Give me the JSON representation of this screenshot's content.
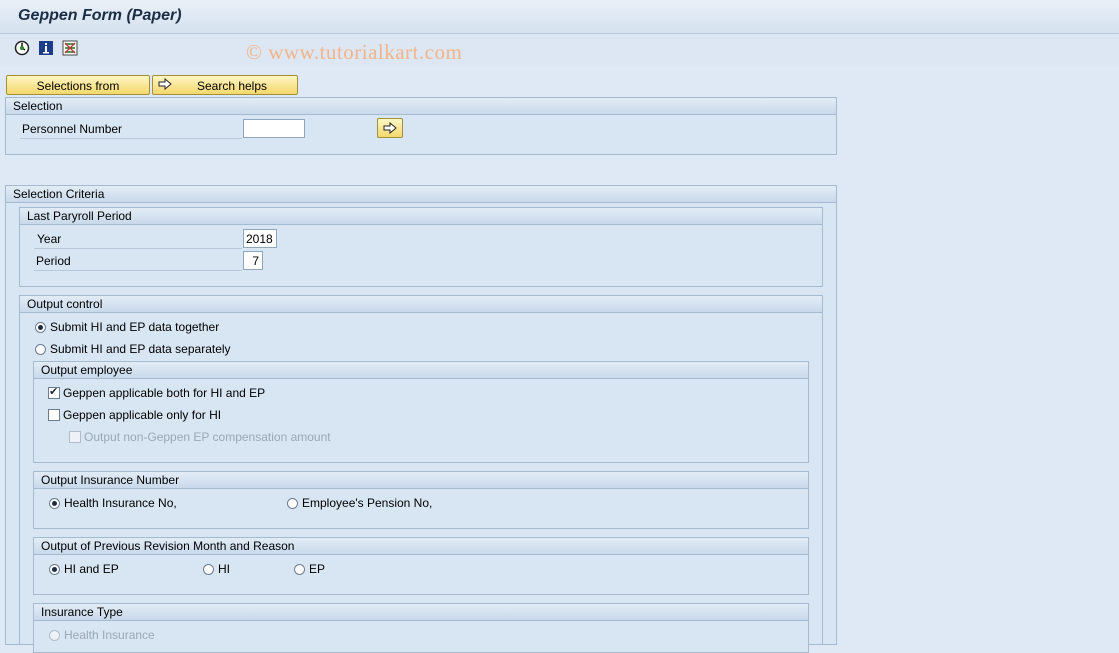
{
  "window": {
    "title": "Geppen Form (Paper)"
  },
  "toolbar": {
    "icons": [
      "execute-icon",
      "info-icon",
      "selection-options-icon"
    ],
    "watermark": "© www.tutorialkart.com"
  },
  "buttons": {
    "selections_from": "Selections from",
    "search_helps": "Search helps"
  },
  "selection": {
    "header": "Selection",
    "personnel_number_label": "Personnel Number",
    "personnel_number_value": ""
  },
  "criteria": {
    "header": "Selection Criteria",
    "last_payroll": {
      "header": "Last Paryroll Period",
      "year_label": "Year",
      "year_value": "2018",
      "period_label": "Period",
      "period_value": "7"
    },
    "output_control": {
      "header": "Output control",
      "opt_together": "Submit HI and EP data together",
      "opt_separately": "Submit HI and EP data separately",
      "selected": "together"
    },
    "output_employee": {
      "header": "Output employee",
      "both_label": "Geppen applicable both for HI and EP",
      "both_checked": true,
      "only_hi_label": "Geppen applicable only for HI",
      "only_hi_checked": false,
      "non_geppen_label": "Output non-Geppen EP compensation amount",
      "non_geppen_checked": false
    },
    "output_insurance": {
      "header": "Output Insurance Number",
      "health": "Health Insurance No,",
      "pension": "Employee's Pension No,",
      "selected": "health"
    },
    "prev_revision": {
      "header": "Output of Previous Revision Month and Reason",
      "hi_and_ep": "HI and EP",
      "hi": "HI",
      "ep": "EP",
      "selected": "hi_and_ep"
    },
    "insurance_type": {
      "header": "Insurance Type",
      "health": "Health Insurance"
    }
  },
  "colors": {
    "background": "#dfe9f5",
    "button": "#f3d86b",
    "watermark": "#f2b488"
  }
}
